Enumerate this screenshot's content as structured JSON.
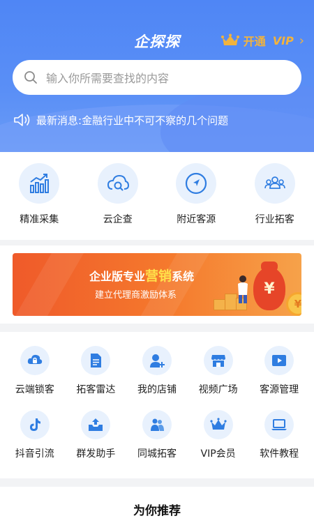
{
  "app": {
    "title": "企探探"
  },
  "vip": {
    "open_label": "开通",
    "vip_label": "VIP",
    "chevron": "›",
    "icon": "crown-icon"
  },
  "search": {
    "placeholder": "输入你所需要查找的内容",
    "icon": "search-icon"
  },
  "news": {
    "label": "最新消息:",
    "text": "金融行业中不可不察的几个问题",
    "icon": "speaker-icon"
  },
  "features": [
    {
      "label": "精准采集",
      "icon": "bar-chart-icon"
    },
    {
      "label": "云企查",
      "icon": "cloud-search-icon"
    },
    {
      "label": "附近客源",
      "icon": "navigation-icon"
    },
    {
      "label": "行业拓客",
      "icon": "group-icon"
    }
  ],
  "banner": {
    "title_pre": "企业版专业",
    "title_highlight": "营销",
    "title_post": "系统",
    "subtitle": "建立代理商激励体系",
    "bag_symbol": "¥",
    "coin_symbol": "¥"
  },
  "tools": [
    {
      "label": "云端锁客",
      "icon": "cloud-lock-icon"
    },
    {
      "label": "拓客雷达",
      "icon": "document-icon"
    },
    {
      "label": "我的店铺",
      "icon": "user-add-icon"
    },
    {
      "label": "视频广场",
      "icon": "store-icon"
    },
    {
      "label": "客源管理",
      "icon": "play-icon"
    },
    {
      "label": "抖音引流",
      "icon": "tiktok-icon"
    },
    {
      "label": "群发助手",
      "icon": "upload-tray-icon"
    },
    {
      "label": "同城拓客",
      "icon": "people-icon"
    },
    {
      "label": "VIP会员",
      "icon": "crown-icon"
    },
    {
      "label": "软件教程",
      "icon": "laptop-icon"
    }
  ],
  "recommend": {
    "title": "为你推荐"
  },
  "colors": {
    "primary": "#4f86f5",
    "accent_gold": "#f2b33d",
    "banner_orange": "#ef5a2a",
    "icon_bg": "#e8f1fd",
    "icon_blue": "#2f7de1"
  }
}
